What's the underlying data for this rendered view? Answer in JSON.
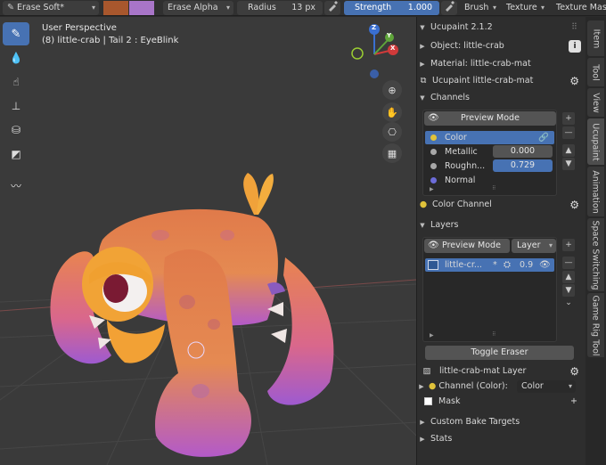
{
  "header": {
    "brush_preset": "Erase Soft*",
    "colors": {
      "primary": "#a8572d",
      "secondary": "#a875c8"
    },
    "blend_mode": "Erase Alpha",
    "radius_label": "Radius",
    "radius_value": "13 px",
    "strength_label": "Strength",
    "strength_value": "1.000",
    "menus": [
      "Brush",
      "Texture",
      "Texture Mask"
    ]
  },
  "viewport": {
    "perspective": "User Perspective",
    "object_info": "(8) little-crab | Tail 2 : EyeBlink",
    "gizmo": {
      "z": "Z",
      "y": "Y",
      "x": "X"
    }
  },
  "panel": {
    "title": "Ucupaint 2.1.2",
    "object_label": "Object: little-crab",
    "material_label": "Material: little-crab-mat",
    "ucupaint_label": "Ucupaint little-crab-mat",
    "channels_header": "Channels",
    "preview_mode": "Preview Mode",
    "channels": [
      {
        "name": "Color",
        "color": "#e0c23a",
        "value": ""
      },
      {
        "name": "Metallic",
        "color": "#a8a8a8",
        "value": "0.000"
      },
      {
        "name": "Roughn...",
        "color": "#a8a8a8",
        "value": "0.729"
      },
      {
        "name": "Normal",
        "color": "#6c6cd8",
        "value": ""
      }
    ],
    "color_channel_label": "Color Channel",
    "layers_header": "Layers",
    "layer_preview_mode": "Preview Mode",
    "layer_dropdown": "Layer",
    "layer": {
      "name": "little-cr...",
      "marker": "*",
      "opacity": "0.9"
    },
    "toggle_eraser": "Toggle Eraser",
    "mat_layer": "little-crab-mat Layer",
    "channel_color_label": "Channel (Color):",
    "channel_color_value": "Color",
    "mask_label": "Mask",
    "custom_bake": "Custom Bake Targets",
    "stats": "Stats"
  },
  "tabs": [
    "Item",
    "Tool",
    "View",
    "Ucupaint",
    "Animation",
    "Space Switching",
    "Game Rig Tool"
  ],
  "active_tab": "Ucupaint"
}
